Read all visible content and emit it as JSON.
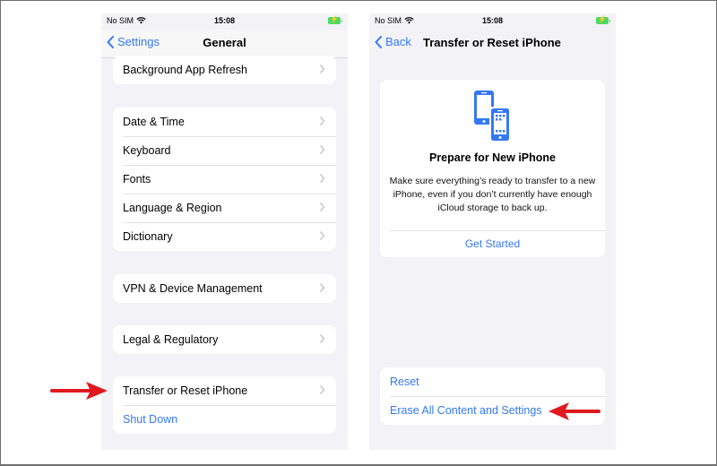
{
  "left_screen": {
    "status": {
      "carrier": "No SIM",
      "time": "15:08"
    },
    "nav": {
      "back_label": "Settings",
      "title": "General"
    },
    "groups": [
      {
        "items": [
          {
            "label": "Background App Refresh",
            "chevron": true
          }
        ]
      },
      {
        "items": [
          {
            "label": "Date & Time",
            "chevron": true
          },
          {
            "label": "Keyboard",
            "chevron": true
          },
          {
            "label": "Fonts",
            "chevron": true
          },
          {
            "label": "Language & Region",
            "chevron": true
          },
          {
            "label": "Dictionary",
            "chevron": true
          }
        ]
      },
      {
        "items": [
          {
            "label": "VPN & Device Management",
            "chevron": true
          }
        ]
      },
      {
        "items": [
          {
            "label": "Legal & Regulatory",
            "chevron": true
          }
        ]
      },
      {
        "items": [
          {
            "label": "Transfer or Reset iPhone",
            "chevron": true
          },
          {
            "label": "Shut Down",
            "chevron": false,
            "style": "link"
          }
        ]
      }
    ]
  },
  "right_screen": {
    "status": {
      "carrier": "No SIM",
      "time": "15:08"
    },
    "nav": {
      "back_label": "Back",
      "title": "Transfer or Reset iPhone"
    },
    "card": {
      "icon": "two-phones-icon",
      "title": "Prepare for New iPhone",
      "description": "Make sure everything’s ready to transfer to a new iPhone, even if you don’t currently have enough iCloud storage to back up.",
      "action_label": "Get Started"
    },
    "actions": [
      {
        "label": "Reset"
      },
      {
        "label": "Erase All Content and Settings"
      }
    ]
  },
  "annotations": {
    "arrow_color": "#e0191f",
    "left_arrow_target": "Transfer or Reset iPhone",
    "right_arrow_target": "Erase All Content and Settings"
  },
  "colors": {
    "accent": "#3478f6",
    "background": "#f2f2f7",
    "battery": "#4cd964"
  }
}
